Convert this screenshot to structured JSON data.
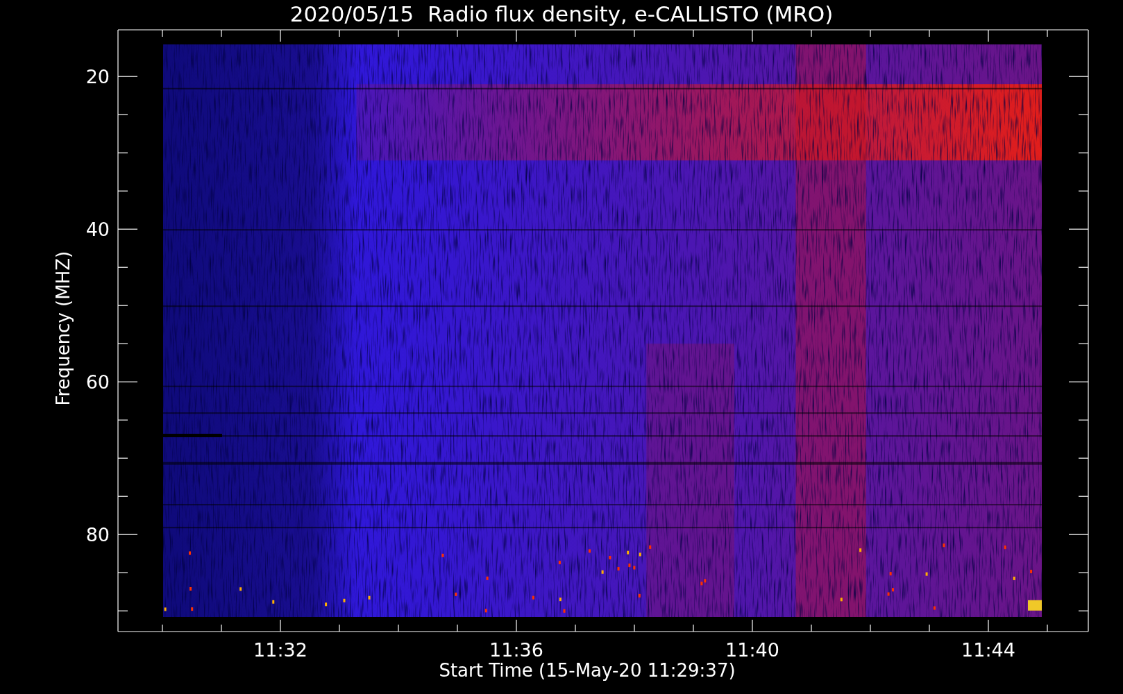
{
  "title": "2020/05/15  Radio flux density, e-CALLISTO (MRO)",
  "y_axis": {
    "label": "Frequency (MHZ)",
    "ticks": [
      "20",
      "40",
      "60",
      "80"
    ]
  },
  "x_axis": {
    "label": "Start Time (15-May-20 11:29:37)",
    "ticks": [
      "11:32",
      "11:36",
      "11:40",
      "11:44"
    ]
  }
}
